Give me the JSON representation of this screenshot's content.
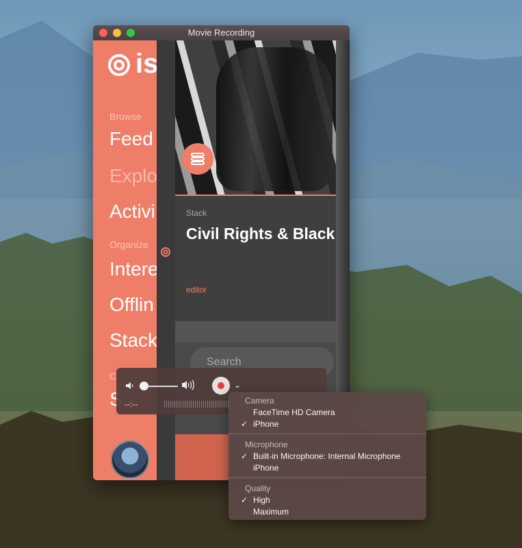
{
  "window": {
    "title": "Movie Recording"
  },
  "sidebar": {
    "logo_text": "is",
    "sections": [
      {
        "label": "Browse",
        "items": [
          "Feed",
          "Explo",
          "Activi"
        ]
      },
      {
        "label": "Organize",
        "items": [
          "Intere",
          "Offlin",
          "Stack"
        ]
      },
      {
        "label": "C",
        "items": [
          "S"
        ]
      }
    ]
  },
  "content": {
    "card_label": "Stack",
    "card_title": "Civil Rights & Black H",
    "card_editor": "editor",
    "search_placeholder": "Search"
  },
  "player": {
    "time": "--:--",
    "volume_level": 0.1
  },
  "menu": {
    "groups": [
      {
        "header": "Camera",
        "items": [
          {
            "label": "FaceTime HD Camera",
            "checked": false
          },
          {
            "label": "iPhone",
            "checked": true
          }
        ]
      },
      {
        "header": "Microphone",
        "items": [
          {
            "label": "Built-in Microphone: Internal Microphone",
            "checked": true
          },
          {
            "label": "iPhone",
            "checked": false
          }
        ]
      },
      {
        "header": "Quality",
        "items": [
          {
            "label": "High",
            "checked": true
          },
          {
            "label": "Maximum",
            "checked": false
          }
        ]
      }
    ],
    "check_glyph": "✓"
  },
  "colors": {
    "accent": "#ef7e68",
    "record": "#e53c3c"
  }
}
